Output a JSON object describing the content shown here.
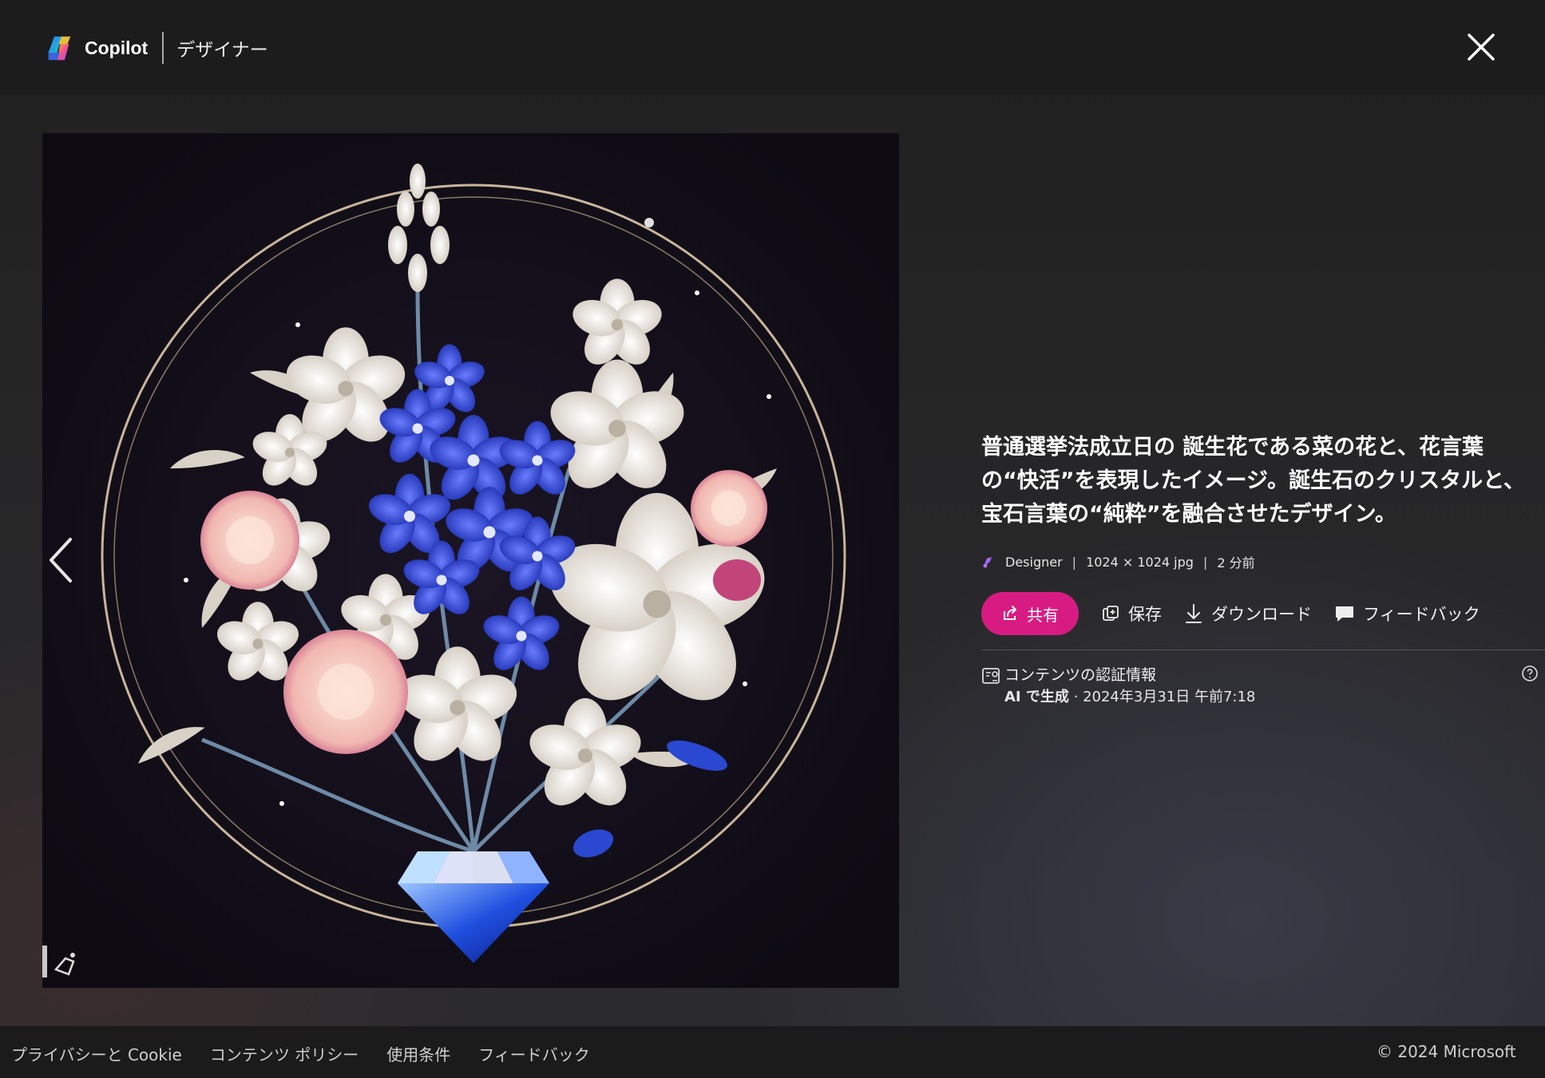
{
  "header": {
    "brand": "Copilot",
    "product": "デザイナー"
  },
  "image": {
    "alt": "普通選挙法成立日の 誕生花である菜の花と、花言葉の“快活”を表現したイメージ。誕生石のクリスタルと、宝石言葉の“純粋”を融合させたデザイン。"
  },
  "details": {
    "title": "普通選挙法成立日の 誕生花である菜の花と、花言葉の“快活”を表現したイメージ。誕生石のクリスタルと、宝石言葉の“純粋”を融合させたデザイン。",
    "source": "Designer",
    "dimensions": "1024 × 1024 jpg",
    "time_ago": "2 分前",
    "separator": "|"
  },
  "actions": {
    "share": "共有",
    "save": "保存",
    "download": "ダウンロード",
    "feedback": "フィードバック"
  },
  "credentials": {
    "title": "コンテンツの認証情報",
    "generated_label": "AI で生成",
    "generated_date": " · 2024年3月31日 午前7:18"
  },
  "footer": {
    "links": [
      "プライバシーと Cookie",
      "コンテンツ ポリシー",
      "使用条件",
      "フィードバック"
    ],
    "copyright": "© 2024 Microsoft"
  },
  "colors": {
    "accent": "#d81b82",
    "header_bg": "#1c1c1c",
    "footer_bg": "#1b1b1b"
  },
  "icons": [
    "copilot-logo-icon",
    "close-icon",
    "chevron-left-icon",
    "designer-icon",
    "share-icon",
    "save-icon",
    "download-icon",
    "feedback-icon",
    "content-credentials-icon",
    "help-icon"
  ]
}
